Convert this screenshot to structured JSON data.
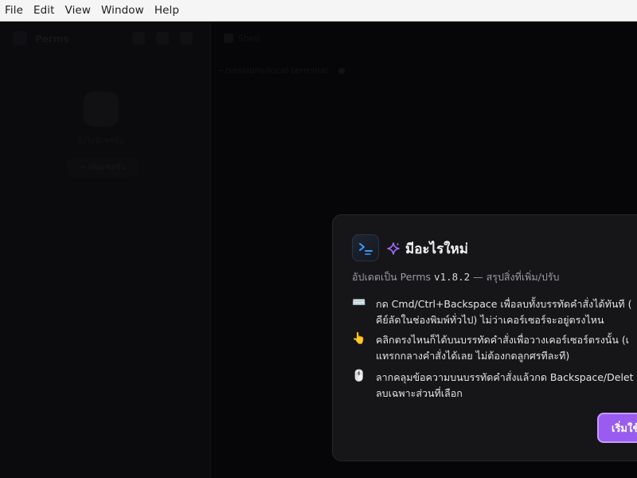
{
  "menubar": {
    "items": [
      {
        "label": "File"
      },
      {
        "label": "Edit"
      },
      {
        "label": "View"
      },
      {
        "label": "Window"
      },
      {
        "label": "Help"
      }
    ]
  },
  "sidebar": {
    "title": "Perms",
    "empty_text": "ยังไม่มีเซสชัน",
    "add_label": "+ เพิ่มเซสชัน"
  },
  "main": {
    "tab_label": "Shell",
    "path_text": "~/sessions/local-terminal"
  },
  "dialog": {
    "title": "มีอะไรใหม่",
    "subtitle_prefix": "อัปเดตเป็น Perms ",
    "version": "v1.8.2",
    "subtitle_suffix": " — สรุปสิ่งที่เพิ่ม/ปรับ",
    "features": [
      {
        "icon": "keyboard-icon",
        "glyph": "⌨️",
        "line1": "กด Cmd/Ctrl+Backspace เพื่อลบทั้งบรรทัดคำสั่งได้ทันที (",
        "line2": "คีย์ลัดในช่องพิมพ์ทั่วไป) ไม่ว่าเคอร์เซอร์จะอยู่ตรงไหน"
      },
      {
        "icon": "pointing-hand-icon",
        "glyph": "👆",
        "line1": "คลิกตรงไหนก็ได้บนบรรทัดคำสั่งเพื่อวางเคอร์เซอร์ตรงนั้น (เ",
        "line2": "แทรกกลางคำสั่งได้เลย ไม่ต้องกดลูกศรทีละที)"
      },
      {
        "icon": "mouse-icon",
        "glyph": "🖱️",
        "line1": "ลากคลุมข้อความบนบรรทัดคำสั่งแล้วกด Backspace/Delet",
        "line2": "ลบเฉพาะส่วนที่เลือก"
      }
    ],
    "primary_button": "เริ่มใช้งาน",
    "colors": {
      "accent": "#9a5cf0",
      "accent_border": "#c49bff",
      "sparkle": "#a36bff",
      "icon_blue": "#3b9bff"
    }
  }
}
